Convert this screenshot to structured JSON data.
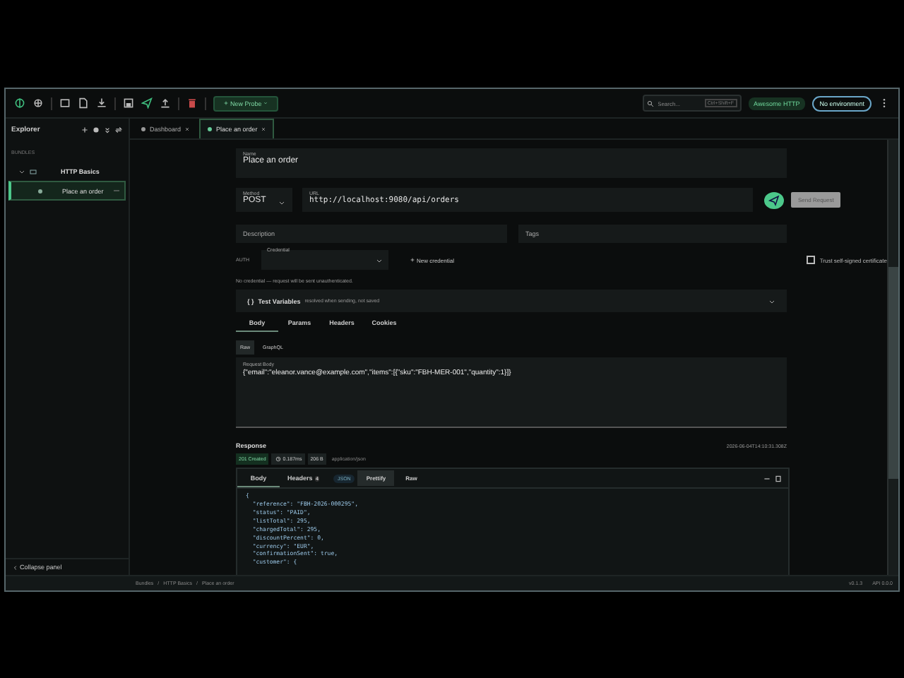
{
  "toolbar": {
    "new_probe": "New Probe",
    "search": {
      "placeholder": "Search...",
      "shortcut": "Ctrl+Shift+F"
    },
    "workspace": "Awesome HTTP",
    "environment": "No environment"
  },
  "sidebar": {
    "title": "Explorer",
    "section": "BUNDLES",
    "tree": [
      {
        "label": "HTTP Basics",
        "expanded": true,
        "selected": false,
        "children": [
          {
            "label": "Place an order",
            "selected": true
          }
        ]
      }
    ],
    "collapse": "Collapse panel"
  },
  "tabs": [
    {
      "label": "Dashboard",
      "selected": false
    },
    {
      "label": "Place an order",
      "selected": true
    }
  ],
  "request": {
    "name_label": "Name",
    "name": "Place an order",
    "method_label": "Method",
    "method": "POST",
    "url_label": "URL",
    "url": "http://localhost:9080/api/orders",
    "send": "Send Request",
    "description_placeholder": "Description",
    "tags_placeholder": "Tags",
    "auth_label": "AUTH",
    "credential_label": "Credential",
    "new_credential": "New credential",
    "trust_label": "Trust self-signed certificate",
    "trust_checked": false,
    "auth_note": "No credential — request will be sent unauthenticated.",
    "test_vars": {
      "icon": "{ }",
      "label": "Test Variables",
      "note": "resolved when sending, not saved",
      "expanded": false
    },
    "tabs": [
      {
        "label": "Body",
        "selected": true
      },
      {
        "label": "Params",
        "selected": false
      },
      {
        "label": "Headers",
        "selected": false
      },
      {
        "label": "Cookies",
        "selected": false
      }
    ],
    "body_modes": [
      {
        "label": "Raw",
        "selected": true
      },
      {
        "label": "GraphQL",
        "selected": false
      }
    ],
    "body_label": "Request Body",
    "body": "{\"email\":\"eleanor.vance@example.com\",\"items\":[{\"sku\":\"FBH-MER-001\",\"quantity\":1}]}"
  },
  "response": {
    "title": "Response",
    "timestamp": "2026-06-04T14:10:31.308Z",
    "status": "201 Created",
    "time": "0.187ms",
    "size": "206 B",
    "content_type": "application/json",
    "tabs": [
      {
        "label": "Body",
        "selected": true
      },
      {
        "label": "Headers",
        "selected": false,
        "count": "4"
      }
    ],
    "format": "JSON",
    "views": [
      {
        "label": "Prettify",
        "selected": true
      },
      {
        "label": "Raw",
        "selected": false
      }
    ],
    "lines": [
      "{",
      "  \"reference\": \"FBH-2026-000295\",",
      "  \"status\": \"PAID\",",
      "  \"listTotal\": 295,",
      "  \"chargedTotal\": 295,",
      "  \"discountPercent\": 0,",
      "  \"currency\": \"EUR\",",
      "  \"confirmationSent\": true,",
      "  \"customer\": {"
    ]
  },
  "status_bar": {
    "breadcrumbs": [
      "Bundles",
      "HTTP Basics",
      "Place an order"
    ],
    "separator": "/",
    "version": "v0.1.3",
    "api": "API 0.0.0"
  }
}
